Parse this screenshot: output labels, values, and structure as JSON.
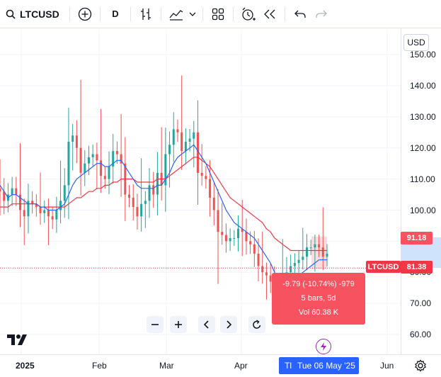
{
  "toolbar": {
    "symbol": "LTCUSD",
    "interval": "D"
  },
  "price_axis": {
    "currency": "USD",
    "ticks": [
      "150.00",
      "140.00",
      "130.00",
      "120.00",
      "110.00",
      "100.00",
      "90.00",
      "80.00",
      "70.00",
      "60.00"
    ],
    "last_price_label": "81.38",
    "crosshair_price_label": "91.18",
    "symbol_tag": "LTCUSD"
  },
  "time_axis": {
    "ticks": [
      "2025",
      "Feb",
      "Mar",
      "Apr",
      "Jun"
    ],
    "crosshair_prefix": "Tl",
    "crosshair_date": "Tue 06 May '25"
  },
  "measure_tooltip": {
    "change": "-9.79 (-10.74%) -979",
    "bars": "5 bars, 5d",
    "volume": "Vol 60.38 K"
  },
  "colors": {
    "up": "#26a69a",
    "down": "#ef5350",
    "ma_fast": "#2962ff",
    "ma_slow": "#f23645",
    "tooltip_bg": "#f7525f",
    "highlight": "#bbd9fb"
  },
  "chart_data": {
    "type": "line",
    "title": "",
    "ylim": [
      55,
      157
    ],
    "y_ticks": [
      60,
      70,
      80,
      90,
      100,
      110,
      120,
      130,
      140,
      150
    ],
    "x_labels": [
      "2025",
      "Feb",
      "Mar",
      "Apr",
      "Jun"
    ],
    "series": [
      {
        "values": [
          106,
          103,
          105,
          107,
          105,
          100,
          98,
          103,
          102,
          101,
          99,
          100,
          98,
          97,
          100,
          103,
          108,
          122,
          124,
          120,
          112,
          115,
          117,
          118,
          116,
          111,
          110,
          114,
          119,
          118,
          115,
          105,
          104,
          101,
          98,
          102,
          103,
          108,
          105,
          112,
          108,
          118,
          121,
          126,
          125,
          119,
          122,
          123,
          125,
          112,
          111,
          110,
          104,
          100,
          93,
          92,
          90,
          91,
          91,
          94,
          93,
          90,
          89,
          86,
          82,
          80,
          79,
          77,
          73,
          72,
          76,
          80,
          82,
          83,
          84,
          85,
          88,
          88,
          89,
          88,
          85,
          86
        ]
      },
      {
        "values": [
          108,
          106,
          104,
          105,
          105,
          104,
          103,
          102,
          102,
          102,
          101,
          101,
          100,
          100,
          100,
          101,
          102,
          105,
          108,
          110,
          111,
          112,
          113,
          114,
          115,
          115,
          114,
          114,
          115,
          116,
          116,
          114,
          112,
          110,
          108,
          107,
          107,
          107,
          107,
          108,
          108,
          110,
          112,
          115,
          117,
          118,
          119,
          120,
          121,
          119,
          117,
          115,
          112,
          109,
          106,
          103,
          100,
          98,
          96,
          95,
          94,
          93,
          92,
          91,
          89,
          87,
          85,
          83,
          80,
          78,
          77,
          77,
          78,
          78,
          79,
          80,
          81,
          82,
          83,
          84,
          84,
          84
        ]
      },
      {
        "values": [
          101,
          101,
          101,
          102,
          102,
          102,
          102,
          102,
          102,
          102,
          101,
          101,
          101,
          101,
          101,
          101,
          101,
          102,
          103,
          104,
          104,
          105,
          106,
          106,
          107,
          107,
          108,
          108,
          109,
          109,
          110,
          110,
          110,
          110,
          109,
          109,
          109,
          109,
          109,
          110,
          110,
          110,
          111,
          112,
          113,
          114,
          115,
          116,
          117,
          117,
          116,
          115,
          114,
          112,
          110,
          108,
          106,
          104,
          103,
          102,
          101,
          100,
          99,
          98,
          97,
          96,
          94,
          93,
          91,
          90,
          89,
          88,
          87,
          87,
          87,
          87,
          87,
          87,
          87,
          87,
          87,
          87
        ]
      }
    ]
  }
}
